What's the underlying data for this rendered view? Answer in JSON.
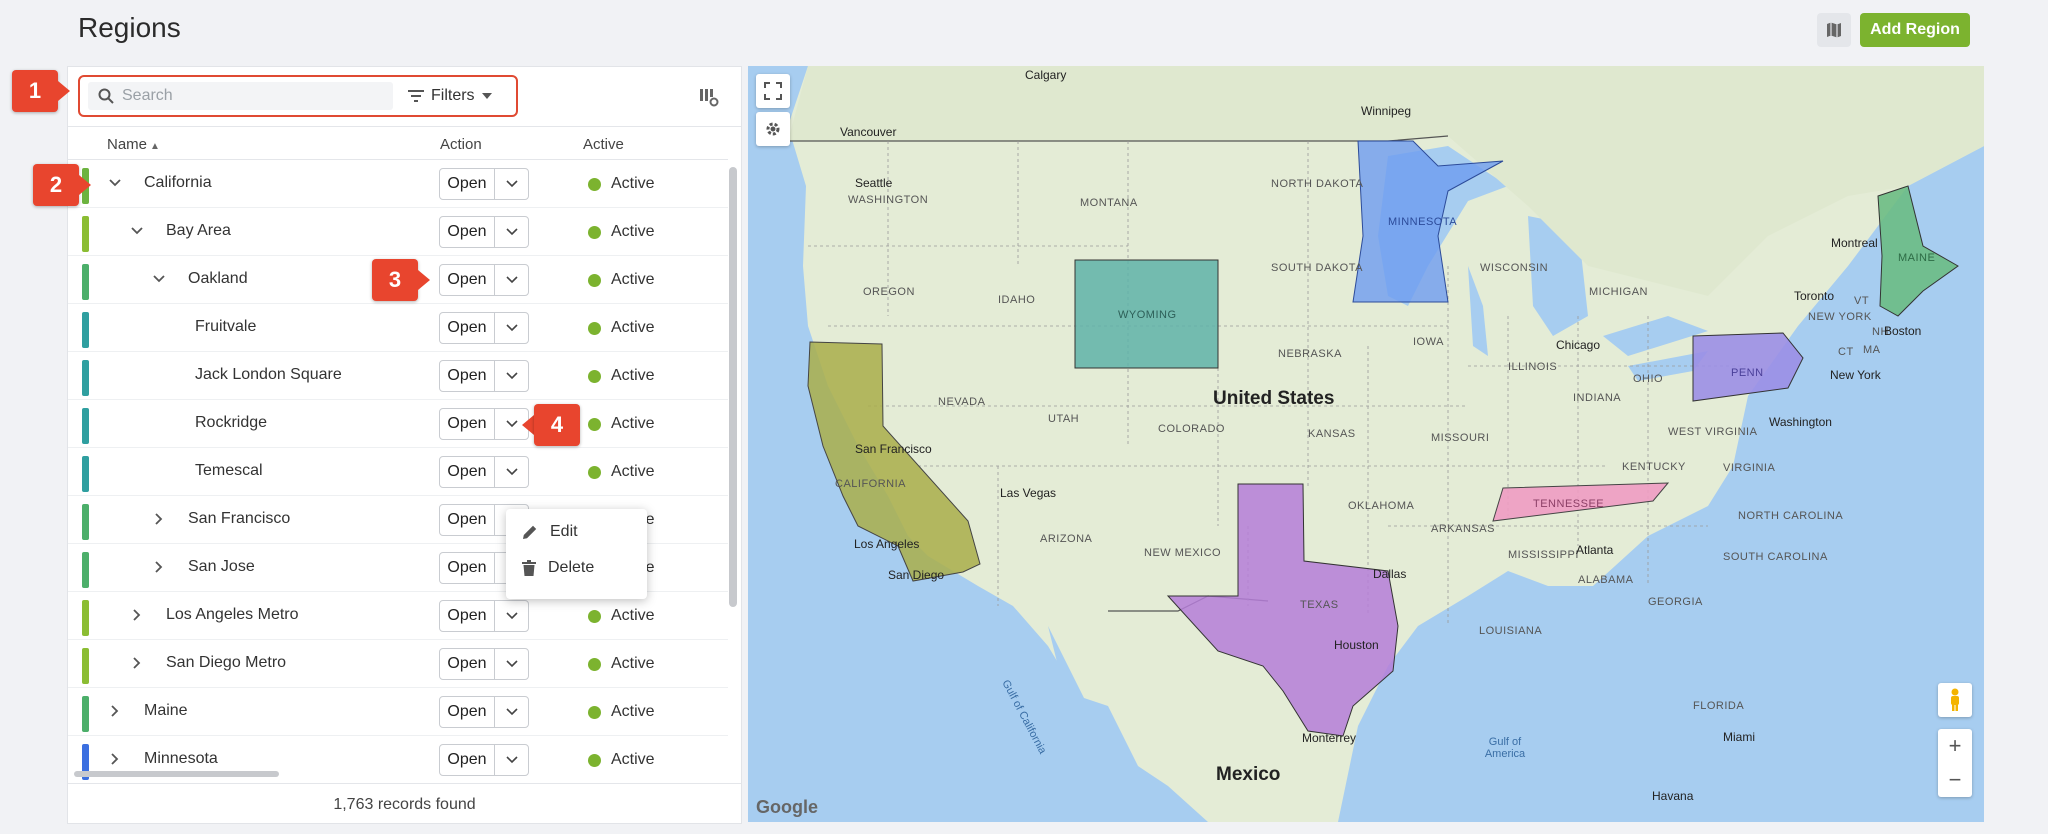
{
  "header": {
    "title": "Regions",
    "add_button": "Add Region"
  },
  "toolbar": {
    "search_placeholder": "Search",
    "filters_label": "Filters"
  },
  "table": {
    "columns": {
      "name": "Name",
      "action": "Action",
      "active": "Active"
    },
    "open_label": "Open",
    "rows": [
      {
        "name": "California",
        "status": "Active",
        "color": "#6cb33f"
      },
      {
        "name": "Bay Area",
        "status": "Active",
        "color": "#8bbd33"
      },
      {
        "name": "Oakland",
        "status": "Active",
        "color": "#4caf6a"
      },
      {
        "name": "Fruitvale",
        "status": "Active",
        "color": "#2f9fa0"
      },
      {
        "name": "Jack London Square",
        "status": "Active",
        "color": "#2f9fa0"
      },
      {
        "name": "Rockridge",
        "status": "Active",
        "color": "#2f9fa0"
      },
      {
        "name": "Temescal",
        "status": "Active",
        "color": "#2f9fa0"
      },
      {
        "name": "San Francisco",
        "status": "Active",
        "color": "#4caf6a"
      },
      {
        "name": "San Jose",
        "status": "Active",
        "color": "#4caf6a"
      },
      {
        "name": "Los Angeles Metro",
        "status": "Active",
        "color": "#8bbd33"
      },
      {
        "name": "San Diego Metro",
        "status": "Active",
        "color": "#8bbd33"
      },
      {
        "name": "Maine",
        "status": "Active",
        "color": "#4caf6a"
      },
      {
        "name": "Minnesota",
        "status": "Active",
        "color": "#3b6fe0"
      }
    ],
    "footer": "1,763 records found"
  },
  "dropdown": {
    "edit": "Edit",
    "delete": "Delete"
  },
  "callouts": [
    "1",
    "2",
    "3",
    "4"
  ],
  "map": {
    "country_labels": {
      "us": "United States",
      "mexico": "Mexico"
    },
    "state_labels": {
      "minnesota": "MINNESOTA",
      "wyoming": "WYOMING",
      "california": "CALIFORNIA",
      "texas": "TEXAS",
      "tennessee": "TENNESSEE",
      "penn": "PENN",
      "maine": "MAINE",
      "north_dakota": "NORTH DAKOTA",
      "south_dakota": "SOUTH DAKOTA",
      "montana": "MONTANA",
      "washington": "WASHINGTON",
      "oregon": "OREGON",
      "idaho": "IDAHO",
      "nevada": "NEVADA",
      "utah": "UTAH",
      "colorado": "COLORADO",
      "arizona": "ARIZONA",
      "new_mexico": "NEW MEXICO",
      "nebraska": "NEBRASKA",
      "kansas": "KANSAS",
      "oklahoma": "OKLAHOMA",
      "iowa": "IOWA",
      "missouri": "MISSOURI",
      "arkansas": "ARKANSAS",
      "illinois": "ILLINOIS",
      "indiana": "INDIANA",
      "ohio": "OHIO",
      "kentucky": "KENTUCKY",
      "wisconsin": "WISCONSIN",
      "michigan": "MICHIGAN",
      "mississippi": "MISSISSIPPI",
      "alabama": "ALABAMA",
      "georgia": "GEORGIA",
      "louisiana": "LOUISIANA",
      "west_virginia": "WEST VIRGINIA",
      "virginia": "VIRGINIA",
      "north_carolina": "NORTH CAROLINA",
      "south_carolina": "SOUTH CAROLINA",
      "florida": "FLORIDA",
      "new_york": "NEW YORK",
      "vt": "VT",
      "nh": "NH",
      "ma": "MA",
      "ct": "CT"
    },
    "cities": {
      "calgary": "Calgary",
      "winnipeg": "Winnipeg",
      "vancouver": "Vancouver",
      "seattle": "Seattle",
      "montreal": "Montreal",
      "toronto": "Toronto",
      "boston": "Boston",
      "chicago": "Chicago",
      "new_york": "New York",
      "washington": "Washington",
      "san_francisco": "San Francisco",
      "las_vegas": "Las Vegas",
      "los_angeles": "Los Angeles",
      "san_diego": "San Diego",
      "atlanta": "Atlanta",
      "dallas": "Dallas",
      "houston": "Houston",
      "monterrey": "Monterrey",
      "miami": "Miami",
      "havana": "Havana"
    },
    "water": {
      "gulf_california": "Gulf of California",
      "gulf_america": "Gulf of America"
    },
    "attribution": "Google"
  }
}
